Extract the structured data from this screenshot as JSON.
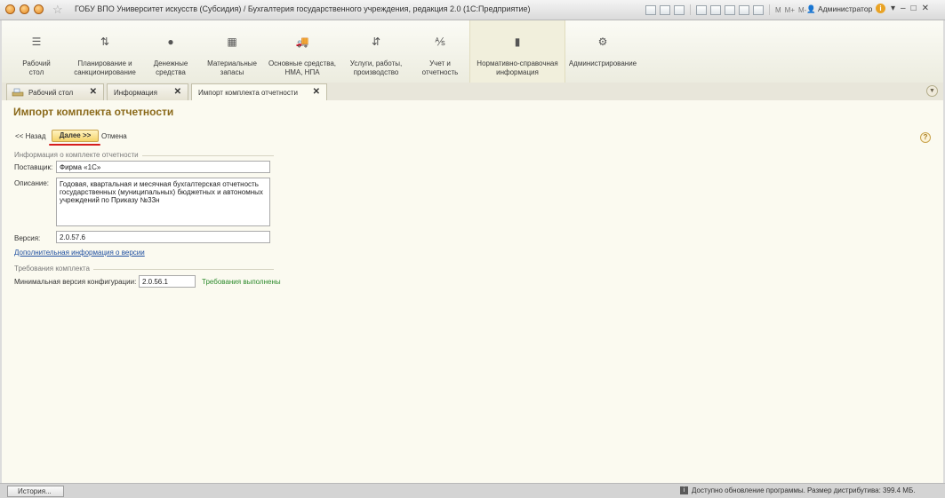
{
  "window": {
    "title": "ГОБУ ВПО Университет искусств (Субсидия) / Бухгалтерия государственного учреждения, редакция 2.0  (1С:Предприятие)",
    "user": "Администратор",
    "tools": {
      "m": "M",
      "mplus": "M+",
      "mminus": "M-"
    }
  },
  "sections": [
    {
      "label": "Рабочий\nстол",
      "icon": "menu-lines-icon"
    },
    {
      "label": "Планирование и\nсанкционирование",
      "icon": "planning-icon"
    },
    {
      "label": "Денежные\nсредства",
      "icon": "money-icon"
    },
    {
      "label": "Материальные\nзапасы",
      "icon": "grid-icon"
    },
    {
      "label": "Основные средства,\nНМА, НПА",
      "icon": "truck-icon"
    },
    {
      "label": "Услуги, работы,\nпроизводство",
      "icon": "arrows-icon"
    },
    {
      "label": "Учет и\nотчетность",
      "icon": "accounting-icon"
    },
    {
      "label": "Нормативно-справочная\nинформация",
      "icon": "book-icon"
    },
    {
      "label": "Администрирование",
      "icon": "gear-icon"
    }
  ],
  "tabs": [
    {
      "label": "Рабочий стол"
    },
    {
      "label": "Информация"
    },
    {
      "label": "Импорт комплекта отчетности"
    }
  ],
  "form": {
    "title": "Импорт комплекта отчетности",
    "buttons": {
      "back": "<< Назад",
      "next": "Далее >>",
      "cancel": "Отмена",
      "help": "?"
    },
    "info_group": "Информация о комплекте отчетности",
    "supplier_label": "Поставщик:",
    "supplier_value": "Фирма «1С»",
    "description_label": "Описание:",
    "description_value": "Годовая, квартальная и месячная бухгалтерская отчетность государственных (муниципальных) бюджетных и автономных учреждений по Приказу №33н",
    "version_label": "Версия:",
    "version_value": "2.0.57.6",
    "more_info_link": "Дополнительная информация о версии",
    "req_group": "Требования комплекта",
    "min_config_label": "Минимальная версия конфигурации:",
    "min_config_value": "2.0.56.1",
    "requirements_status": "Требования выполнены"
  },
  "statusbar": {
    "history": "История...",
    "message": "Доступно обновление программы. Размер дистрибутива: 399.4 МБ."
  },
  "colors": {
    "title": "#8b6a1b",
    "accent_underline": "#d61d1d",
    "link": "#1f4fa0",
    "ok": "#2e8b2e"
  }
}
